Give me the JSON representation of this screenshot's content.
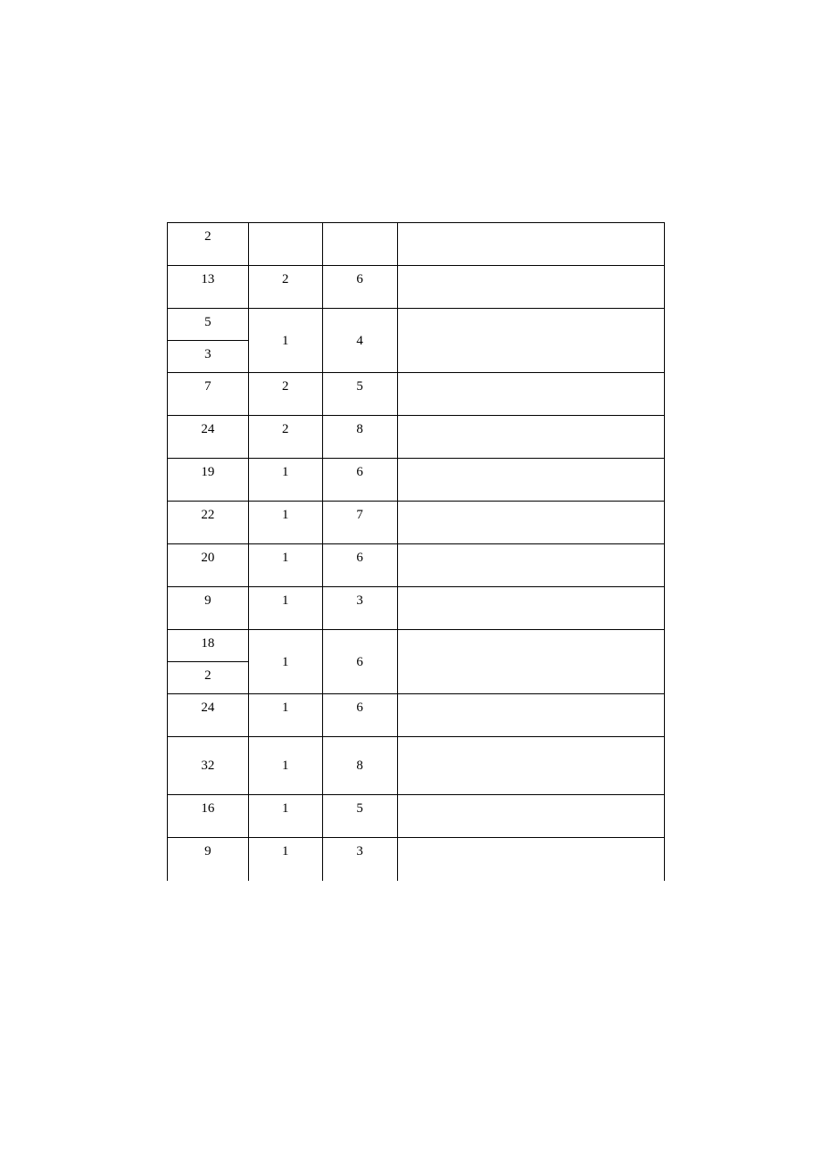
{
  "table": {
    "rows": [
      {
        "c1": "2",
        "c2": "",
        "c3": "",
        "c4": ""
      },
      {
        "c1": "13",
        "c2": "2",
        "c3": "6",
        "c4": ""
      },
      {
        "c1": "5",
        "c2_merged": "1",
        "c3_merged": "4",
        "c4": ""
      },
      {
        "c1": "3",
        "c4": ""
      },
      {
        "c1": "7",
        "c2": "2",
        "c3": "5",
        "c4": ""
      },
      {
        "c1": "24",
        "c2": "2",
        "c3": "8",
        "c4": ""
      },
      {
        "c1": "19",
        "c2": "1",
        "c3": "6",
        "c4": ""
      },
      {
        "c1": "22",
        "c2": "1",
        "c3": "7",
        "c4": ""
      },
      {
        "c1": "20",
        "c2": "1",
        "c3": "6",
        "c4": ""
      },
      {
        "c1": "9",
        "c2": "1",
        "c3": "3",
        "c4": ""
      },
      {
        "c1": "18",
        "c2_merged": "1",
        "c3_merged": "6",
        "c4": ""
      },
      {
        "c1": "2",
        "c4": ""
      },
      {
        "c1": "24",
        "c2": "1",
        "c3": "6",
        "c4": ""
      },
      {
        "c1": "32",
        "c2": "1",
        "c3": "8",
        "c4": "",
        "tall": true
      },
      {
        "c1": "16",
        "c2": "1",
        "c3": "5",
        "c4": ""
      },
      {
        "c1": "9",
        "c2": "1",
        "c3": "3",
        "c4": ""
      }
    ]
  }
}
